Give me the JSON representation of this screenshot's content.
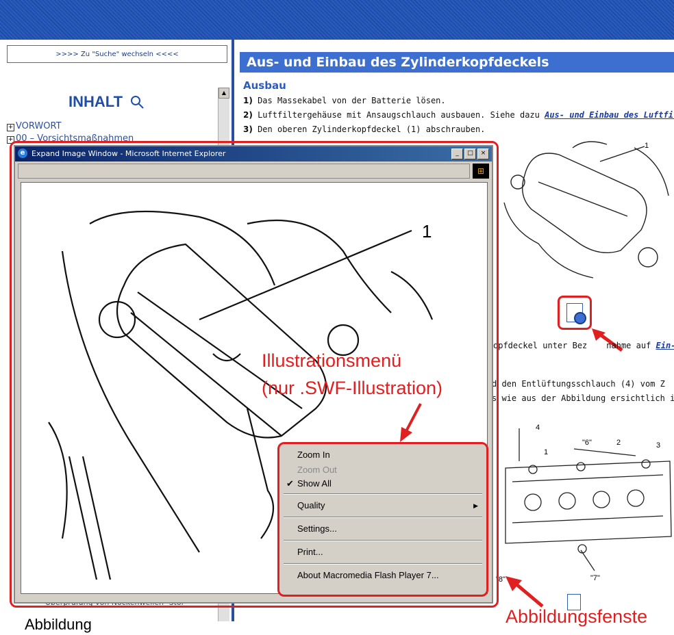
{
  "search_switch": ">>>> Zu \"Suche\" wechseln <<<<",
  "inhalt": "INHALT",
  "toc": [
    "VORWORT",
    "00 – Vorsichtsmaßnahmen"
  ],
  "bg_toc_bottom": "Überprüfung von Nockenwellen- Stör",
  "page_title": "Aus- und Einbau des Zylinderkopfdeckels",
  "subhead": "Ausbau",
  "steps": [
    {
      "num": "1)",
      "text": "Das Massekabel von der Batterie lösen."
    },
    {
      "num": "2)",
      "text": "Luftfiltergehäuse mit Ansaugschlauch ausbauen. Siehe dazu ",
      "link": "Aus- und Einbau des Luftfil"
    },
    {
      "num": "3)",
      "text": "Den oberen Zylinderkopfdeckel (1) abschrauben."
    }
  ],
  "frag1_text": "opfdeckel unter Bez",
  "frag1_text2": "nahme auf ",
  "frag1_link": "Ein-",
  "frag2": "d den Entlüftungsschlauch (4) vom Z",
  "frag3": "s wie aus der Abbildung ersichtlich in r",
  "diagram_labels": {
    "top_one": "1",
    "p4": "4",
    "p1": "1",
    "p6": "\"6\"",
    "p2": "2",
    "p3": "3",
    "p7": "\"7\"",
    "p8": "\"8\""
  },
  "popup": {
    "title": "Expand Image Window - Microsoft Internet Explorer",
    "label_one": "1"
  },
  "context_menu": {
    "zoom_in": "Zoom In",
    "zoom_out": "Zoom Out",
    "show_all": "Show All",
    "quality": "Quality",
    "settings": "Settings...",
    "print": "Print...",
    "about": "About Macromedia Flash Player 7..."
  },
  "callout": {
    "line1": "Illustrationsmenü",
    "line2": "(nur .SWF-Illustration)",
    "bottom": "Abbildungsfenste"
  },
  "caption": "Abbildung",
  "colors": {
    "accent": "#e02020",
    "banner": "#1f4ea8",
    "title_bar": "#3c6fd0"
  }
}
